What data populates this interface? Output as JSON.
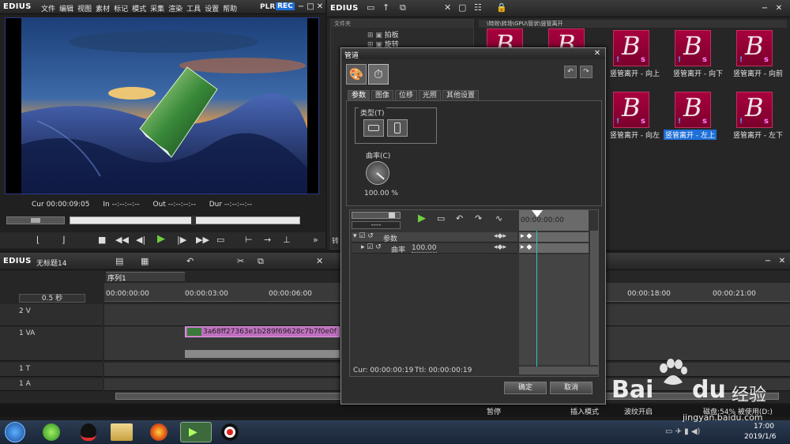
{
  "app": {
    "name": "EDIUS"
  },
  "menu": [
    "文件",
    "编辑",
    "视图",
    "素材",
    "标记",
    "模式",
    "采集",
    "渲染",
    "工具",
    "设置",
    "帮助"
  ],
  "player": {
    "plr": "PLR",
    "rec": "REC"
  },
  "timecodes": {
    "cur_label": "Cur",
    "cur": "00:00:09:05",
    "in_label": "In",
    "in": "--:--:--:--",
    "out_label": "Out",
    "out": "--:--:--:--",
    "dur_label": "Dur",
    "dur": "--:--:--:--"
  },
  "bin": {
    "title": "EDIUS",
    "folder_header": "文件夹",
    "tree": [
      "拍板",
      "旋转"
    ],
    "path": "\\特效\\转场\\GPU\\管状\\竖管离开",
    "items": [
      "竖管离开 - 向上",
      "竖管离开 - 向下",
      "竖管离开 - 向前",
      "竖管离开 - 向左",
      "竖管离开 - 左上",
      "竖管离开 - 左下"
    ],
    "truncated_label": "转"
  },
  "project": {
    "app": "EDIUS",
    "name": "无标题14",
    "sequence_tab": "序列1",
    "scale": "0.5 秒"
  },
  "ruler": [
    "00:00:00:00",
    "00:00:03:00",
    "00:00:06:00",
    "00:00:18:00",
    "00:00:21:00"
  ],
  "tracks": [
    {
      "name": "2 V"
    },
    {
      "name": "1 VA",
      "clip": "3a68ff27363e1b289f69628c7b7f0e0f"
    },
    {
      "name": "1 T"
    },
    {
      "name": "1 A"
    }
  ],
  "dialog": {
    "title": "管道",
    "tabs": [
      "参数",
      "图像",
      "位移",
      "光照",
      "其他设置"
    ],
    "group_label": "类型(T)",
    "knob_label": "曲率(C)",
    "knob_value": "100.00 %",
    "kf_ruler": "00:00:00:00",
    "rows": [
      {
        "name": "参数",
        "value": ""
      },
      {
        "name": "曲率",
        "value": "100.00"
      }
    ],
    "speed": "----",
    "status_cur": "Cur: 00:00:00:19",
    "status_ttl": "Ttl: 00:00:00:19",
    "ok": "确定",
    "cancel": "取消"
  },
  "statusbar": [
    "暂停",
    "插入模式",
    "波纹开启",
    "磁盘:54% 被使用(D:)"
  ],
  "clock": {
    "time": "17:00",
    "date": "2019/1/6"
  },
  "watermark": {
    "brand": "Bai",
    "brand2": "du",
    "cn": "经验",
    "url": "jingyan.baidu.com"
  },
  "colors": {
    "accent": "#1e6fd9",
    "clip": "#c070c0",
    "thumb": "#9a0038",
    "play": "#6fcf3f"
  }
}
